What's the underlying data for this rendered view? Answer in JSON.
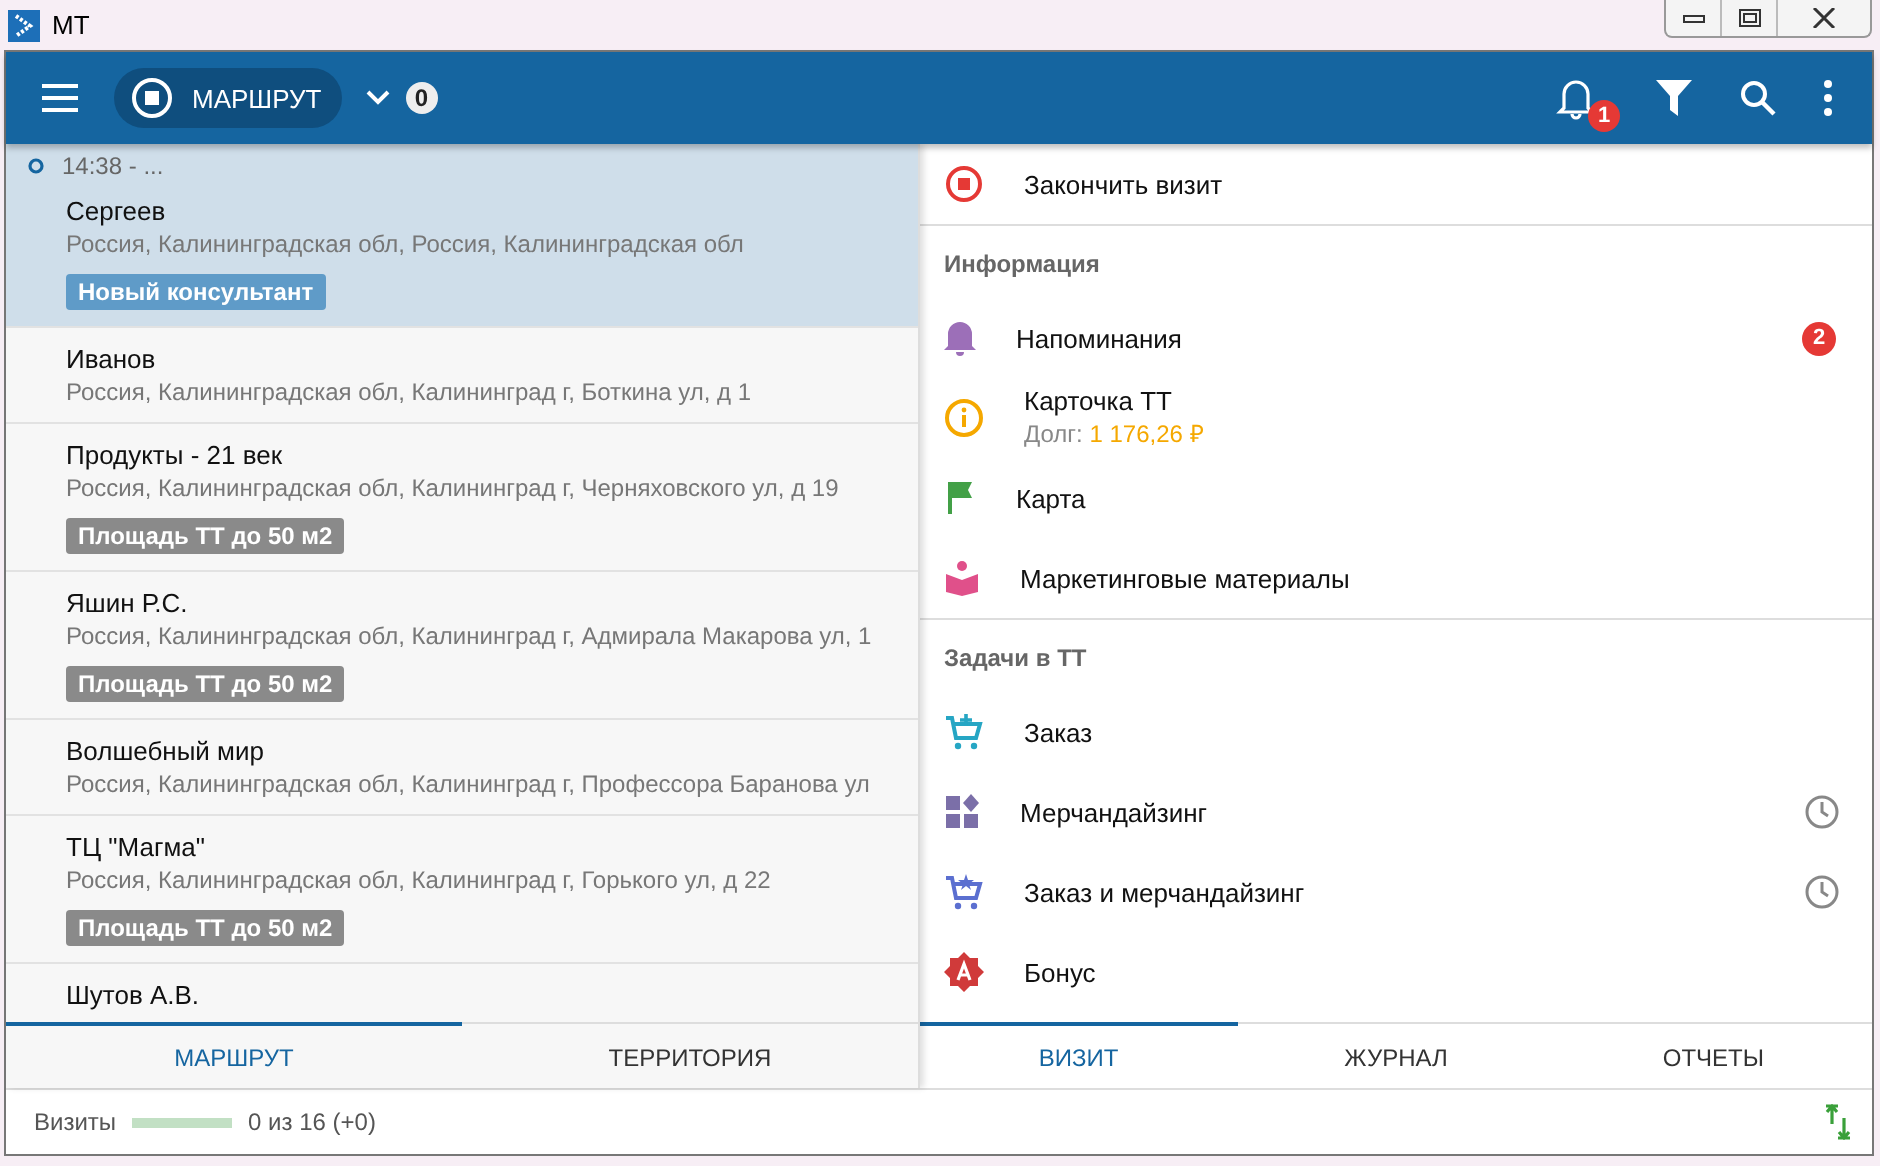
{
  "window": {
    "title": "МТ"
  },
  "toolbar": {
    "route_button": "МАРШРУТ",
    "count": "0",
    "notification_badge": "1"
  },
  "route_list": [
    {
      "time": "14:38 - ...",
      "name": "Сергеев",
      "address": "Россия, Калининградская обл, Россия, Калининградская обл",
      "tag": {
        "label": "Новый консультант",
        "color": "#5f9bc8"
      },
      "selected": true
    },
    {
      "name": "Иванов",
      "address": "Россия, Калининградская обл, Калининград г, Боткина ул, д 1",
      "selected": false
    },
    {
      "name": "Продукты - 21 век",
      "address": "Россия, Калининградская обл, Калининград г, Черняховского ул, д 19",
      "tag": {
        "label": "Площадь ТТ до 50 м2",
        "color": "#8a8a8a"
      },
      "selected": false
    },
    {
      "name": "Яшин Р.С.",
      "address": "Россия, Калининградская обл, Калининград г, Адмирала Макарова ул, 1",
      "tag": {
        "label": "Площадь ТТ до 50 м2",
        "color": "#8a8a8a"
      },
      "selected": false
    },
    {
      "name": "Волшебный мир",
      "address": "Россия, Калининградская обл, Калининград г, Профессора Баранова ул",
      "selected": false
    },
    {
      "name": "ТЦ \"Магма\"",
      "address": "Россия, Калининградская обл, Калининград г, Горького ул, д 22",
      "tag": {
        "label": "Площадь ТТ до 50 м2",
        "color": "#8a8a8a"
      },
      "selected": false
    },
    {
      "name": "Шутов А.В.",
      "selected": false
    }
  ],
  "left_tabs": [
    {
      "label": "МАРШРУТ",
      "selected": true
    },
    {
      "label": "ТЕРРИТОРИЯ",
      "selected": false
    }
  ],
  "visit_panel": {
    "end_visit": "Закончить визит",
    "sections": [
      {
        "title": "Информация",
        "items": [
          {
            "label": "Напоминания",
            "badge": "2"
          },
          {
            "label": "Карточка ТТ",
            "subtitle_label": "Долг:",
            "subtitle_value": "1 176,26 ₽"
          },
          {
            "label": "Карта"
          },
          {
            "label": "Маркетинговые материалы"
          }
        ]
      },
      {
        "title": "Задачи в ТТ",
        "items": [
          {
            "label": "Заказ",
            "pending": false
          },
          {
            "label": "Мерчандайзинг",
            "pending": true
          },
          {
            "label": "Заказ и мерчандайзинг",
            "pending": true
          },
          {
            "label": "Бонус",
            "pending": false
          }
        ]
      }
    ]
  },
  "right_tabs": [
    {
      "label": "ВИЗИТ",
      "selected": true
    },
    {
      "label": "ЖУРНАЛ",
      "selected": false
    },
    {
      "label": "ОТЧЕТЫ",
      "selected": false
    }
  ],
  "status_bar": {
    "label": "Визиты",
    "level": 0,
    "reading": "0 из 16 (+0)"
  }
}
